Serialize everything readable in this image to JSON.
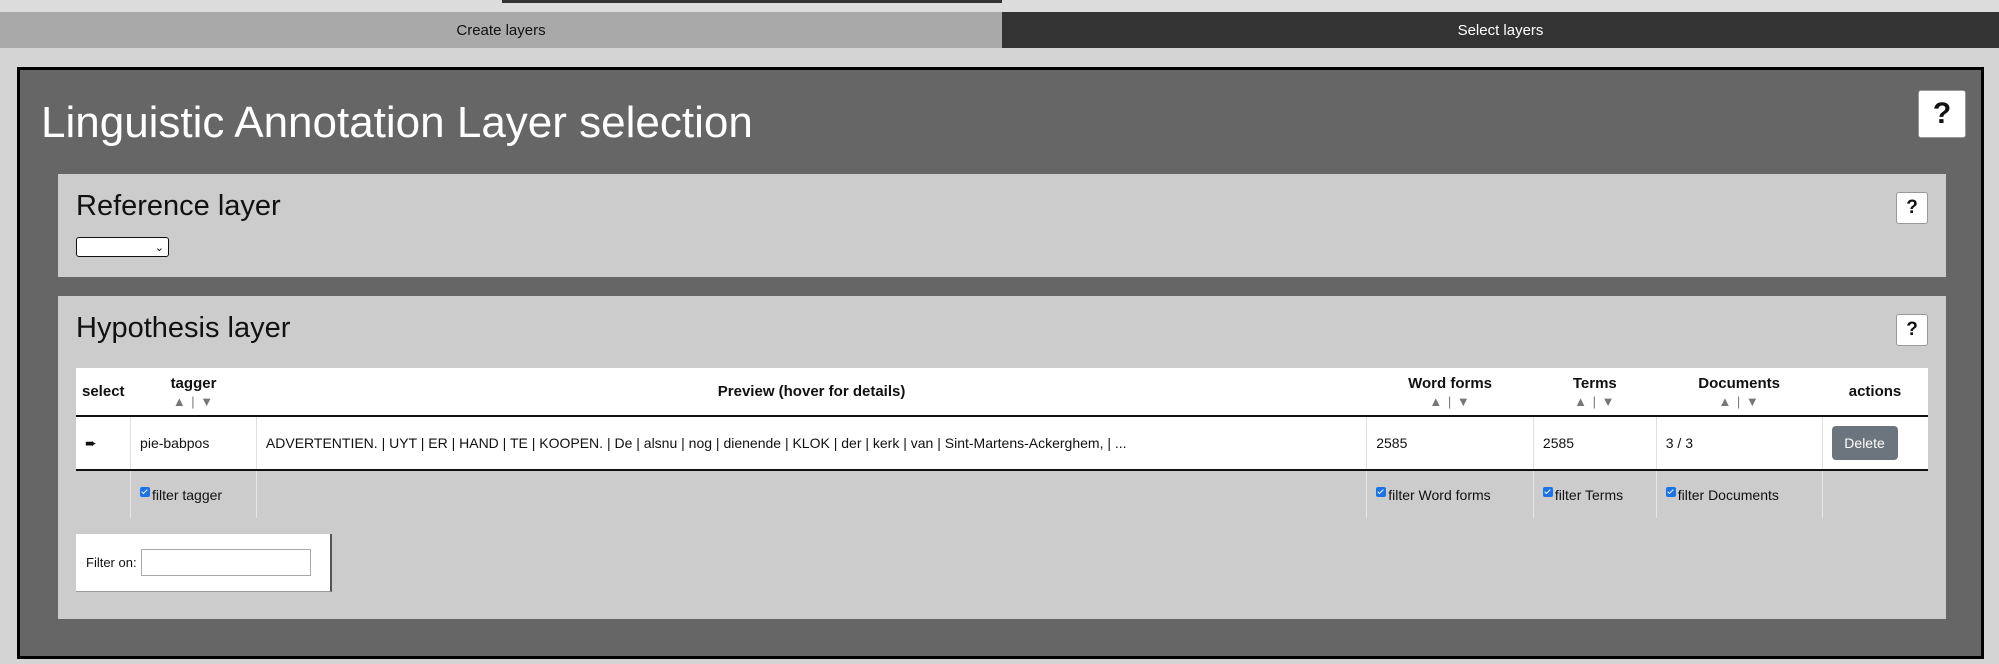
{
  "tabs": [
    {
      "label": "Create layers"
    },
    {
      "label": "Select layers"
    }
  ],
  "main": {
    "title": "Linguistic Annotation Layer selection",
    "help_label": "?"
  },
  "reference": {
    "title": "Reference layer",
    "help_label": "?",
    "selected_value": ""
  },
  "hypothesis": {
    "title": "Hypothesis layer",
    "help_label": "?",
    "columns": {
      "select": "select",
      "tagger": "tagger",
      "preview": "Preview (hover for details)",
      "word_forms": "Word forms",
      "terms": "Terms",
      "documents": "Documents",
      "actions": "actions"
    },
    "sort_glyph": "▲ | ▼",
    "row": {
      "select_icon": "➨",
      "tagger": "pie-babpos",
      "preview": "ADVERTENTIEN. | UYT | ER | HAND | TE | KOOPEN. | De | alsnu | nog | dienende | KLOK | der | kerk | van | Sint-Martens-Ackerghem, | ...",
      "word_forms": "2585",
      "terms": "2585",
      "documents": "3 / 3",
      "delete_label": "Delete"
    },
    "filters": {
      "tagger": "filter tagger",
      "word_forms": "filter Word forms",
      "terms": "filter Terms",
      "documents": "filter Documents"
    },
    "filter_on": {
      "label": "Filter on:",
      "value": ""
    }
  },
  "colors": {
    "main_bg": "#666666",
    "panel_bg": "#cccccc",
    "tab_active_bg": "#333333",
    "tab_inactive_bg": "#a9a9a9",
    "delete_bg": "#6c757d",
    "checkbox": "#1a73e8"
  }
}
